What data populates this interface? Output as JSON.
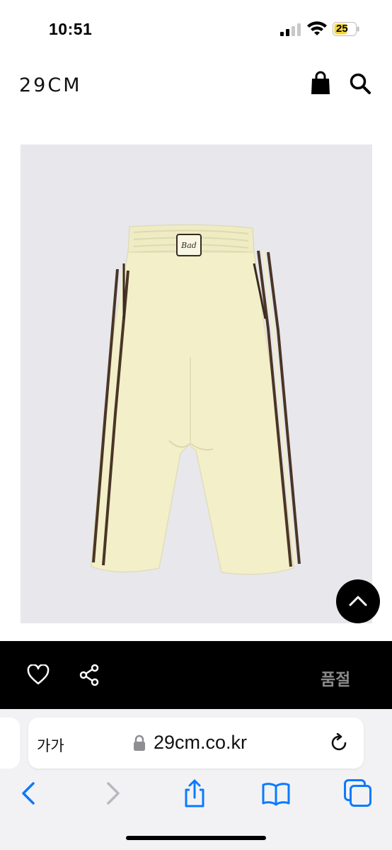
{
  "status": {
    "time": "10:51",
    "battery": "25"
  },
  "header": {
    "logo": "29CM"
  },
  "product": {
    "image_alt": "cream track pants with brown side stripes",
    "patch_text": "Bad",
    "bottom_bar": {
      "status_label": "품절"
    }
  },
  "browser": {
    "text_size_label": "가가",
    "url": "29cm.co.kr"
  },
  "icons": {
    "bag": "shopping-bag-icon",
    "search": "search-icon",
    "scroll_top": "chevron-up-icon",
    "heart": "heart-icon",
    "share": "share-icon",
    "lock": "lock-icon",
    "reload": "reload-icon",
    "back": "back-icon",
    "forward": "forward-icon",
    "share_sheet": "share-sheet-icon",
    "bookmarks": "bookmarks-icon",
    "tabs": "tabs-icon"
  },
  "colors": {
    "pants": "#f2efc9",
    "stripe": "#4a3526",
    "accent": "#0a7aff",
    "bar": "#000000",
    "soldout": "#8a8a8a"
  }
}
